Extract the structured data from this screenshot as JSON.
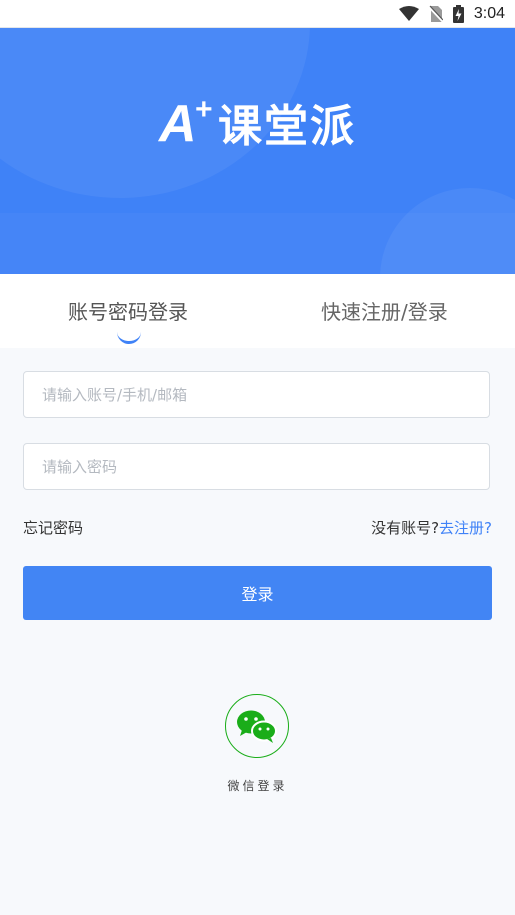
{
  "status_bar": {
    "time": "3:04",
    "icons": [
      "wifi-icon",
      "no-sim-icon",
      "battery-charging-icon"
    ]
  },
  "header": {
    "logo_a": "A",
    "logo_plus": "+",
    "logo_text": "课堂派",
    "background_color": "#3f82f7"
  },
  "tabs": [
    {
      "label": "账号密码登录",
      "active": true
    },
    {
      "label": "快速注册/登录",
      "active": false
    }
  ],
  "form": {
    "account_placeholder": "请输入账号/手机/邮箱",
    "account_value": "",
    "password_placeholder": "请输入密码",
    "password_value": "",
    "forgot_password": "忘记密码",
    "no_account_text": "没有账号?",
    "register_link": "去注册?",
    "login_button": "登录"
  },
  "social": {
    "wechat_icon": "wechat-icon",
    "wechat_label": "微信登录"
  },
  "colors": {
    "accent": "#4285f4",
    "wechat_green": "#1aad19"
  }
}
